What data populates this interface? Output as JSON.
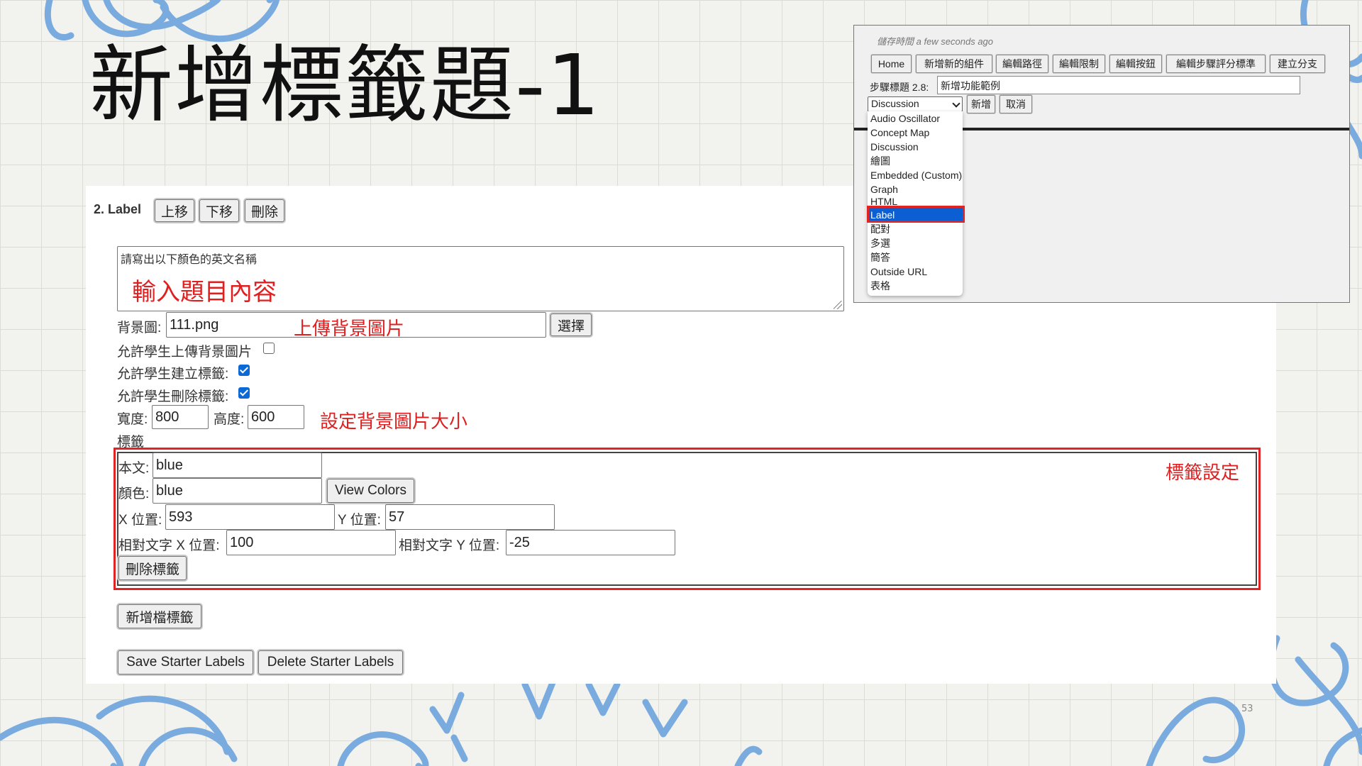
{
  "slide": {
    "title": "新增標籤題-1",
    "page_number": "53"
  },
  "editor": {
    "section_title": "2. Label",
    "move_up": "上移",
    "move_down": "下移",
    "delete": "刪除",
    "prompt_text": "請寫出以下顏色的英文名稱",
    "note_prompt": "輸入題目內容",
    "bg_label": "背景圖:",
    "bg_value": "111.png",
    "note_upload": "上傳背景圖片",
    "choose": "選擇",
    "allow_upload": "允許學生上傳背景圖片",
    "allow_upload_checked": false,
    "allow_create": "允許學生建立標籤:",
    "allow_create_checked": true,
    "allow_delete": "允許學生刪除標籤:",
    "allow_delete_checked": true,
    "width_label": "寬度:",
    "width_value": "800",
    "height_label": "高度:",
    "height_value": "600",
    "note_size": "設定背景圖片大小",
    "labels_heading": "標籤",
    "label_item": {
      "text_label": "本文:",
      "text_value": "blue",
      "color_label": "顏色:",
      "color_value": "blue",
      "view_colors": "View Colors",
      "x_label": "X 位置:",
      "x_value": "593",
      "y_label": "Y 位置:",
      "y_value": "57",
      "rel_x_label": "相對文字 X 位置:",
      "rel_x_value": "100",
      "rel_y_label": "相對文字 Y 位置:",
      "rel_y_value": "-25",
      "delete_label": "刪除標籤"
    },
    "note_label_settings": "標籤設定",
    "add_label": "新增檔標籤",
    "save_starter": "Save Starter Labels",
    "delete_starter": "Delete Starter Labels"
  },
  "inset": {
    "saved_time": "儲存時間 a few seconds ago",
    "toolbar": [
      "Home",
      "新增新的組件",
      "編輯路徑",
      "編輯限制",
      "編輯按鈕",
      "編輯步驟評分標準",
      "建立分支"
    ],
    "step_title_label": "步驟標題 2.8:",
    "step_title_value": "新增功能範例",
    "select_value": "Discussion",
    "add": "新增",
    "cancel": "取消",
    "options": [
      "Audio Oscillator",
      "Concept Map",
      "Discussion",
      "繪圖",
      "Embedded (Custom)",
      "Graph",
      "HTML",
      "Label",
      "配對",
      "多選",
      "簡答",
      "Outside URL",
      "表格"
    ],
    "selected_option": "Label"
  },
  "colors": {
    "annotation_red": "#e02020",
    "selection_blue": "#0b5fd3",
    "decor_blue": "#7aabde"
  }
}
